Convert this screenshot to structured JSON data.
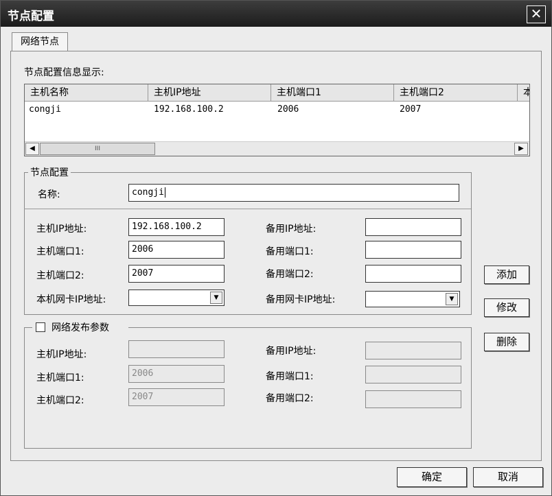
{
  "window": {
    "title": "节点配置"
  },
  "tabs": [
    {
      "label": "网络节点"
    }
  ],
  "list": {
    "caption": "节点配置信息显示:",
    "columns": [
      "主机名称",
      "主机IP地址",
      "主机端口1",
      "主机端口2",
      "本"
    ],
    "rows": [
      [
        "congji",
        "192.168.100.2",
        "2006",
        "2007"
      ]
    ],
    "scroll_thumb": "III"
  },
  "node_config": {
    "group_title": "节点配置",
    "name_label": "名称:",
    "name_value": "congji",
    "host_ip_label": "主机IP地址:",
    "host_ip_value": "192.168.100.2",
    "host_port1_label": "主机端口1:",
    "host_port1_value": "2006",
    "host_port2_label": "主机端口2:",
    "host_port2_value": "2007",
    "nic_ip_label": "本机网卡IP地址:",
    "backup_ip_label": "备用IP地址:",
    "backup_port1_label": "备用端口1:",
    "backup_port2_label": "备用端口2:",
    "backup_nic_ip_label": "备用网卡IP地址:"
  },
  "publish": {
    "group_title": "网络发布参数",
    "host_ip_label": "主机IP地址:",
    "host_port1_label": "主机端口1:",
    "host_port1_value": "2006",
    "host_port2_label": "主机端口2:",
    "host_port2_value": "2007",
    "backup_ip_label": "备用IP地址:",
    "backup_port1_label": "备用端口1:",
    "backup_port2_label": "备用端口2:"
  },
  "buttons": {
    "add": "添加",
    "modify": "修改",
    "delete": "删除",
    "ok": "确定",
    "cancel": "取消"
  }
}
